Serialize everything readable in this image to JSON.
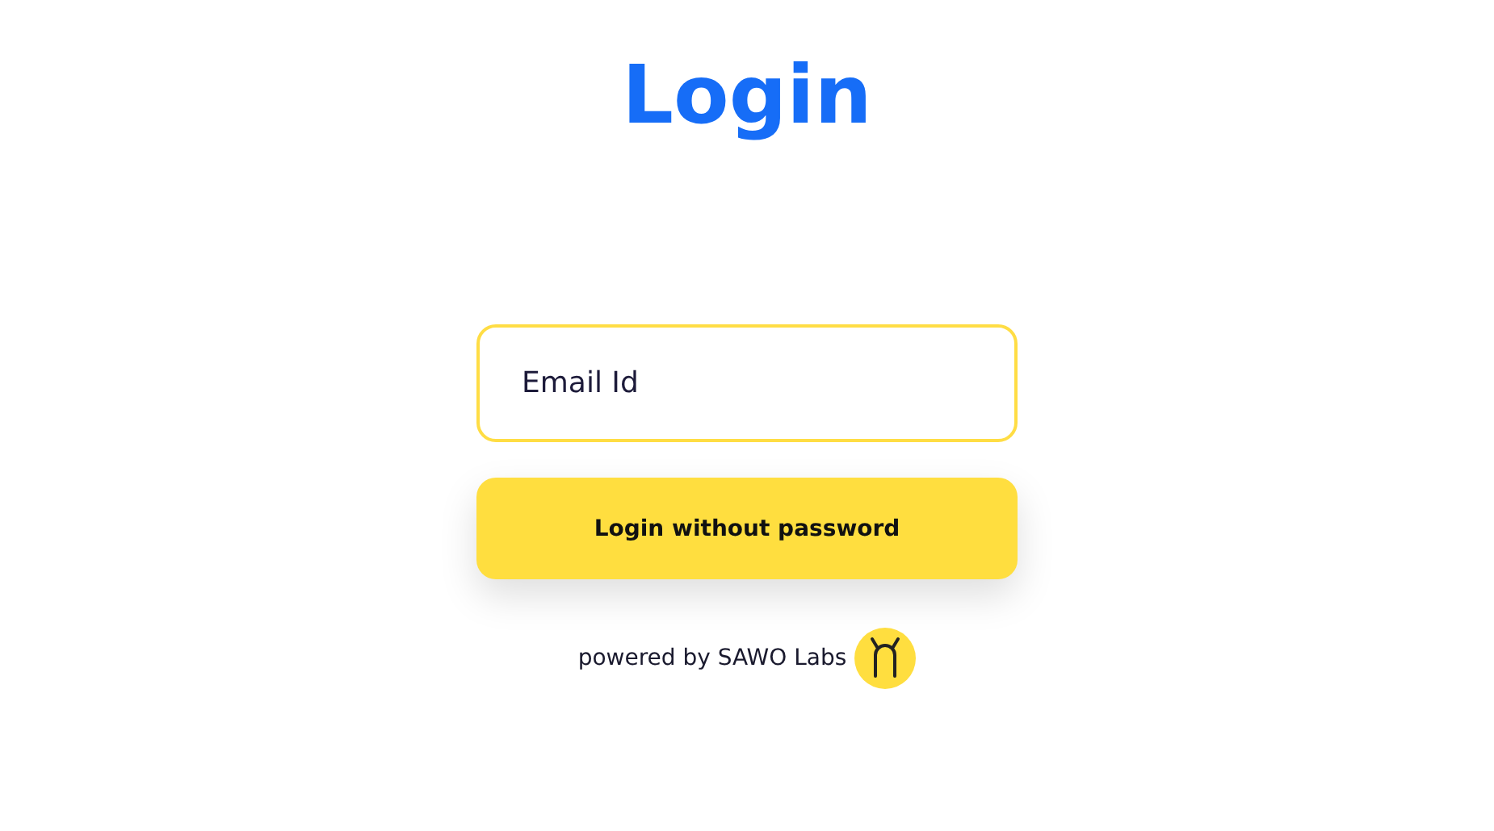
{
  "title": "Login",
  "email_field": {
    "placeholder": "Email Id"
  },
  "login_button": {
    "label": "Login without password"
  },
  "footer": {
    "text": "powered by SAWO Labs"
  }
}
